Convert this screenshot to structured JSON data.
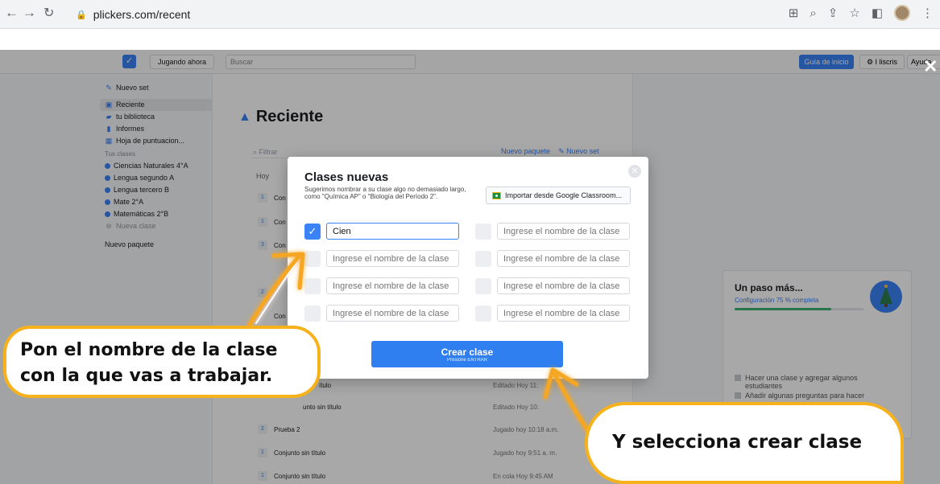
{
  "browser": {
    "url": "plickers.com/recent"
  },
  "topnav": {
    "play_label": "Jugando ahora",
    "search_placeholder": "Buscar",
    "guide_label": "Guía de inicio",
    "user_label": "I liscris",
    "help_label": "Ayuda"
  },
  "sidebar": {
    "new_set": "Nuevo set",
    "items": [
      {
        "label": "Reciente",
        "icon": "clock-icon"
      },
      {
        "label": "tu biblioteca",
        "icon": "folder-icon"
      },
      {
        "label": "Informes",
        "icon": "reports-icon"
      },
      {
        "label": "Hoja de puntuacion...",
        "icon": "scoresheet-icon"
      }
    ],
    "classes_heading": "Tus clases",
    "classes": [
      "Ciencias Naturales 4°A",
      "Lengua segundo A",
      "Lengua tercero B",
      "Mate 2°A",
      "Matemáticas 2°B"
    ],
    "new_class": "Nueva clase",
    "new_package": "Nuevo paquete"
  },
  "main": {
    "title": "Reciente",
    "filter_placeholder": "Filtrar",
    "new_package_link": "Nuevo paquete",
    "new_set_link": "Nuevo set",
    "section_today": "Hoy",
    "rows_hidden": [
      {
        "num": "1",
        "title": "Con"
      },
      {
        "num": "1",
        "title": "Con"
      },
      {
        "num": "3",
        "title": "Con"
      },
      {
        "num": "2",
        "title": ""
      },
      {
        "num": "",
        "title": "Con"
      }
    ],
    "rows": [
      {
        "num": "",
        "title": "ítulo",
        "meta": "Editado Hoy 11:"
      },
      {
        "num": "",
        "title": "unto sin título",
        "meta": "Editado Hoy 10:"
      },
      {
        "num": "2",
        "title": "Prueba 2",
        "meta": "Jugado hoy 10:18 a.m."
      },
      {
        "num": "1",
        "title": "Conjunto sin título",
        "meta": "Jugado hoy 9:51 a. m."
      },
      {
        "num": "1",
        "title": "Conjunto sin título",
        "meta": "En cola Hoy 9:45 AM"
      }
    ]
  },
  "setup_card": {
    "title": "Un paso más...",
    "subtitle": "Configuración 75 % completa",
    "progress": 0.75,
    "tasks": [
      "Hacer una clase y agregar algunos estudiantes",
      "Añadir algunas preguntas para hacer"
    ]
  },
  "modal": {
    "title": "Clases nuevas",
    "subtitle": "Sugerimos nombrar a su clase algo no demasiado largo, como \"Química AP\" o \"Biología del Período 2\".",
    "google_button": "Importar desde Google Classroom...",
    "first_value": "Cien",
    "placeholder": "Ingrese el nombre de la clase",
    "create_label": "Crear clase",
    "create_hint": "Presione ENTRAR"
  },
  "callouts": {
    "left_line1": "Pon el nombre de la clase",
    "left_line2": "con la que vas a trabajar.",
    "right": "Y selecciona crear clase"
  },
  "colors": {
    "accent": "#3b82f6",
    "callout_border": "#f7b21b"
  }
}
